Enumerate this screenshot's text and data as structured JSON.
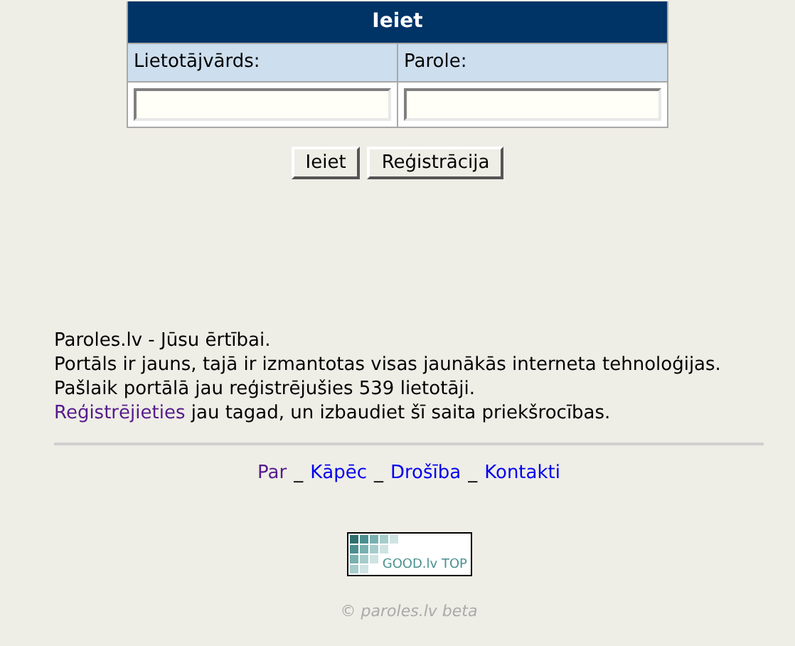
{
  "login": {
    "title": "Ieiet",
    "fields": [
      {
        "label": "Lietotājvārds:"
      },
      {
        "label": "Parole:"
      }
    ],
    "buttons": [
      "Ieiet",
      "Reģistrācija"
    ]
  },
  "intro": {
    "lines": [
      {
        "text": "Paroles.lv - Jūsu ērtībai."
      },
      {
        "text": "Portāls ir jauns, tajā ir izmantotas visas jaunākās interneta tehnoloģijas."
      },
      {
        "text": "Pašlaik portālā jau reģistrējušies 539 lietotāji."
      },
      {
        "link": "Reģistrējieties",
        "link_visited": true,
        "text": " jau tagad, un izbaudiet šī saita priekšrocības."
      }
    ]
  },
  "footer": [
    {
      "kind": "link",
      "label": "Par",
      "visited": true
    },
    {
      "kind": "separator",
      "label": "_"
    },
    {
      "kind": "link",
      "label": "Kāpēc",
      "visited": false
    },
    {
      "kind": "separator",
      "label": "_"
    },
    {
      "kind": "link",
      "label": "Drošība",
      "visited": false
    },
    {
      "kind": "separator",
      "label": "_"
    },
    {
      "kind": "link",
      "label": "Kontakti",
      "visited": false
    }
  ],
  "badge": {
    "text": "GOOD.lv TOP"
  },
  "copyright": "© paroles.lv beta"
}
